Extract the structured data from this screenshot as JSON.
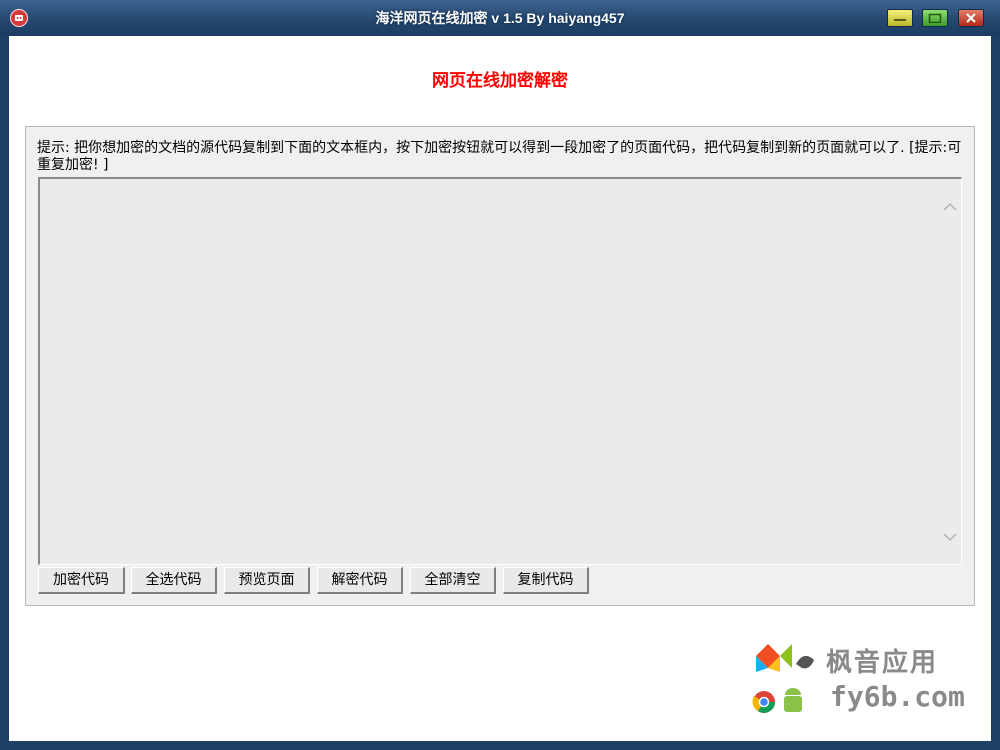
{
  "window": {
    "title": "海洋网页在线加密 v 1.5  By haiyang457",
    "icons": {
      "app": "app-icon",
      "minimize": "minimize-icon",
      "maximize": "maximize-icon",
      "close": "close-icon"
    }
  },
  "main": {
    "heading": "网页在线加密解密",
    "hint": "提示: 把你想加密的文档的源代码复制到下面的文本框内，按下加密按钮就可以得到一段加密了的页面代码，把代码复制到新的页面就可以了. [提示:可重复加密! ]",
    "code_text": "",
    "buttons": [
      {
        "label": "加密代码"
      },
      {
        "label": "全选代码"
      },
      {
        "label": "预览页面"
      },
      {
        "label": "解密代码"
      },
      {
        "label": "全部清空"
      },
      {
        "label": "复制代码"
      }
    ]
  },
  "watermark": {
    "line1": "枫音应用",
    "line2": "fy6b.com"
  },
  "colors": {
    "heading": "#ff0000",
    "titlebar": "#2a4d75",
    "panel": "#f0f0f0",
    "textarea": "#ebebeb"
  }
}
